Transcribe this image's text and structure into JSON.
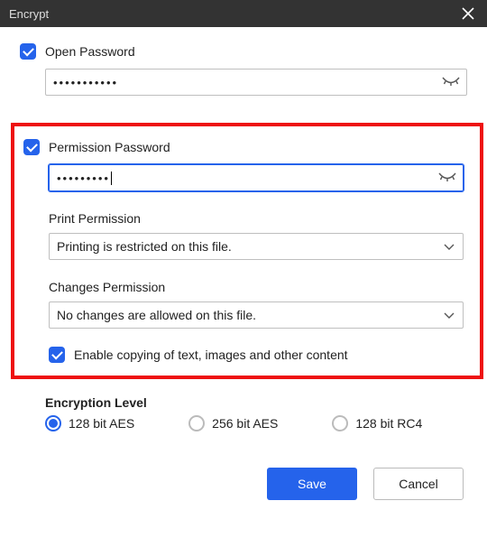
{
  "titlebar": {
    "title": "Encrypt"
  },
  "open_password": {
    "label": "Open Password",
    "checked": true,
    "value": "•••••••••••"
  },
  "permission_password": {
    "label": "Permission Password",
    "checked": true,
    "value": "•••••••••"
  },
  "print_permission": {
    "label": "Print Permission",
    "value": "Printing is restricted on this file."
  },
  "changes_permission": {
    "label": "Changes Permission",
    "value": "No changes are allowed on this file."
  },
  "enable_copy": {
    "label": "Enable copying of text, images and other content",
    "checked": true
  },
  "encryption_level": {
    "label": "Encryption Level",
    "options": [
      {
        "label": "128 bit AES",
        "selected": true
      },
      {
        "label": "256 bit AES",
        "selected": false
      },
      {
        "label": "128 bit RC4",
        "selected": false
      }
    ]
  },
  "buttons": {
    "save": "Save",
    "cancel": "Cancel"
  }
}
